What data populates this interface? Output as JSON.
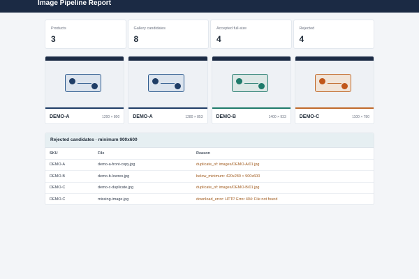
{
  "header": {
    "title": "Image Pipeline Report"
  },
  "stats": [
    {
      "label": "Products",
      "value": "3"
    },
    {
      "label": "Gallery candidates",
      "value": "8"
    },
    {
      "label": "Accepted full-size",
      "value": "4"
    },
    {
      "label": "Rejected",
      "value": "4"
    }
  ],
  "gallery": [
    {
      "sku": "DEMO-A",
      "dims": "1200 × 800",
      "accent": "#1f3d66",
      "dot": "#1f3d66",
      "frame": "#2f5c8f",
      "fill": "#dce4ee"
    },
    {
      "sku": "DEMO-A",
      "dims": "1280 × 853",
      "accent": "#1f3d66",
      "dot": "#1f3d66",
      "frame": "#2f5c8f",
      "fill": "#dce4ee"
    },
    {
      "sku": "DEMO-B",
      "dims": "1400 × 933",
      "accent": "#1e7a6a",
      "dot": "#1e7a6a",
      "frame": "#2a7f72",
      "fill": "#dde8e6"
    },
    {
      "sku": "DEMO-C",
      "dims": "1100 × 780",
      "accent": "#c0692a",
      "dot": "#c0561a",
      "frame": "#c0692a",
      "fill": "#f1e4d8"
    }
  ],
  "rejected": {
    "title": "Rejected candidates · minimum 900x600",
    "columns": [
      "SKU",
      "File",
      "Reason"
    ],
    "rows": [
      {
        "sku": "DEMO-A",
        "file": "demo-a-front-copy.jpg",
        "reason": "duplicate_of: images/DEMO-A/01.jpg"
      },
      {
        "sku": "DEMO-B",
        "file": "demo-b-lowres.jpg",
        "reason": "below_minimum: 420x280 < 900x600"
      },
      {
        "sku": "DEMO-C",
        "file": "demo-c-duplicate.jpg",
        "reason": "duplicate_of: images/DEMO-B/01.jpg"
      },
      {
        "sku": "DEMO-C",
        "file": "missing-image.jpg",
        "reason": "download_error: HTTP Error 404: File not found"
      }
    ]
  }
}
